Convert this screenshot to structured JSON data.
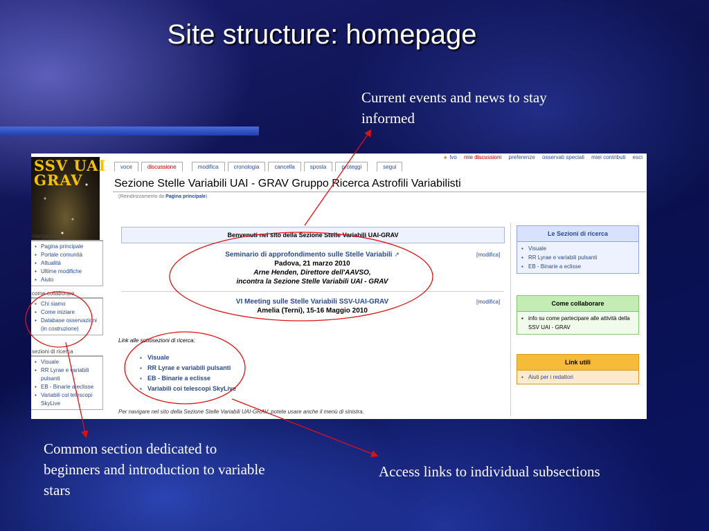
{
  "slide": {
    "title": "Site structure: homepage",
    "callouts": {
      "news": "Current events and news to stay informed",
      "beginners": "Common section dedicated to beginners and introduction to variable stars",
      "subsections": "Access links to individual subsections"
    },
    "annotation_color": "#e01010"
  },
  "wiki": {
    "logo_text": "SSV UAI\nGRAV",
    "user_bar": {
      "user_icon": "user-icon",
      "items": [
        "lvo",
        "mie discussioni",
        "preferenze",
        "osservati speciali",
        "miei contributi",
        "esci"
      ]
    },
    "tabs": [
      "voce",
      "discussione",
      "modifica",
      "cronologia",
      "cancella",
      "sposta",
      "proteggi",
      "segui"
    ],
    "page_title": "Sezione Stelle Variabili UAI - GRAV Gruppo Ricerca Astrofili Variabilisti",
    "redirect": {
      "prefix": "(Reindirizzamento da ",
      "link": "Pagina principale",
      "suffix": ")"
    },
    "sidebar": {
      "navigation": {
        "heading": "navigazione",
        "items": [
          "Pagina principale",
          "Portale comunità",
          "Attualità",
          "Ultime modifiche",
          "Aiuto"
        ]
      },
      "collaborate": {
        "heading": "come collaborare",
        "items": [
          "Chi siamo",
          "Come iniziare",
          "Database osservazioni (in costruzione)"
        ]
      },
      "sections": {
        "heading": "sezioni di ricerca",
        "items": [
          "Visuale",
          "RR Lyrae e variabili pulsanti",
          "EB - Binarie a eclisse",
          "Variabili coi telescopi SkyLive"
        ]
      }
    },
    "welcome": "Benvenuti nel sito della Sezione Stelle Variabili UAI-GRAV",
    "events": [
      {
        "title": "Seminario di approfondimento sulle Stelle Variabili",
        "lines": [
          "Padova, 21 marzo 2010",
          "Arne Henden, Direttore dell'AAVSO,",
          "incontra la Sezione Stelle Variabili UAI - GRAV"
        ],
        "edit": "[modifica]"
      },
      {
        "title": "VI Meeting sulle Stelle Variabili SSV-UAI-GRAV",
        "lines": [
          "Amelia (Terni), 15-16 Maggio 2010"
        ],
        "edit": "[modifica]"
      }
    ],
    "subsections": {
      "label": "Link alle sottosezioni di ricerca:",
      "items": [
        "Visuale",
        "RR Lyrae e variabili pulsanti",
        "EB - Binarie a eclisse",
        "Variabili coi telescopi SkyLive"
      ]
    },
    "footer_note": "Per navigare nel sito della Sezione Stelle Variabili UAI-GRAV, potete usare anche il menù di sinistra.",
    "right_boxes": [
      {
        "title": "Le Sezioni di ricerca",
        "items": [
          "Visuale",
          "RR Lyrae e variabili pulsanti",
          "EB - Binarie a eclisse"
        ],
        "color": "#d8e2ff"
      },
      {
        "title": "Come collaborare",
        "items": [
          "info su come partecipare alle attività della SSV UAI - GRAV"
        ],
        "color": "#c4ecb4"
      },
      {
        "title": "Link utili",
        "items": [
          "Aiuti per i redattori"
        ],
        "color": "#f7bb3a"
      }
    ]
  }
}
